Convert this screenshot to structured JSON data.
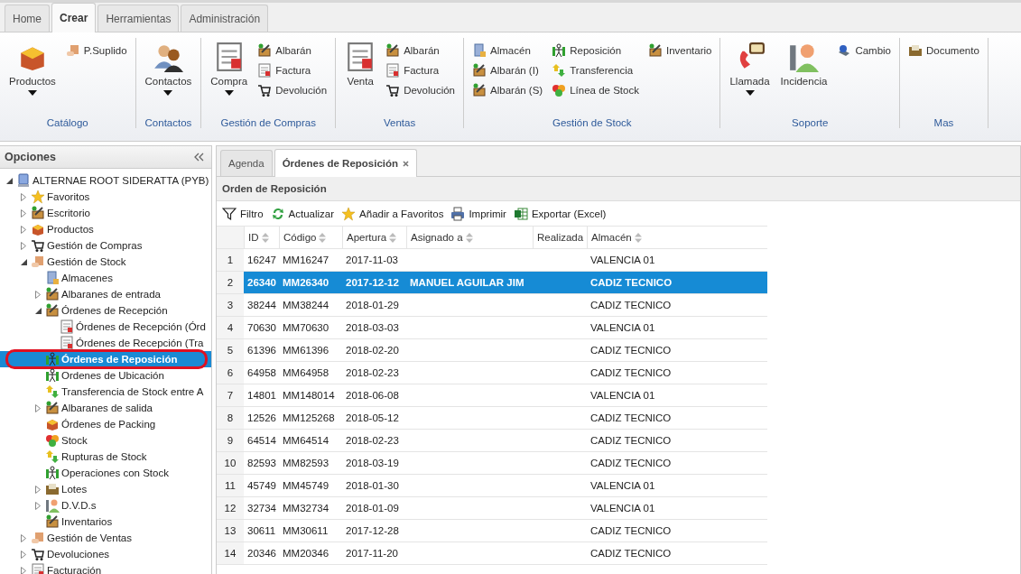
{
  "ribbon_tabs": [
    {
      "label": "Home",
      "selected": false
    },
    {
      "label": "Crear",
      "selected": true
    },
    {
      "label": "Herramientas",
      "selected": false
    },
    {
      "label": "Administración",
      "selected": false
    }
  ],
  "ribbon_groups": [
    {
      "label": "Catálogo",
      "large": [
        {
          "label": "Productos",
          "dropdown": true
        }
      ],
      "small": [
        "P.Suplido"
      ]
    },
    {
      "label": "Contactos",
      "large": [
        {
          "label": "Contactos",
          "dropdown": true
        }
      ]
    },
    {
      "label": "Gestión de Compras",
      "large": [
        {
          "label": "Compra",
          "dropdown": true
        }
      ],
      "small": [
        "Albarán",
        "Factura",
        "Devolución"
      ]
    },
    {
      "label": "Ventas",
      "large": [
        {
          "label": "Venta",
          "dropdown": false
        }
      ],
      "small": [
        "Albarán",
        "Factura",
        "Devolución"
      ]
    },
    {
      "label": "Gestión de Stock",
      "small": [
        "Almacén",
        "Albarán (I)",
        "Albarán (S)",
        "Reposición",
        "Transferencia",
        "Línea de Stock",
        "Inventario"
      ]
    },
    {
      "label": "Soporte",
      "large": [
        {
          "label": "Llamada",
          "dropdown": true
        },
        {
          "label": "Incidencia",
          "dropdown": false
        }
      ],
      "small": [
        "Cambio"
      ]
    },
    {
      "label": "Mas",
      "small": [
        "Documento"
      ]
    }
  ],
  "sidebar": {
    "title": "Opciones",
    "tree": [
      {
        "label": "ALTERNAE ROOT SIDERATTA (PYB)",
        "expanded": true,
        "selected": false,
        "children": [
          {
            "label": "Favoritos",
            "expanded": false,
            "selected": false
          },
          {
            "label": "Escritorio",
            "expanded": false,
            "selected": false
          },
          {
            "label": "Productos",
            "expanded": false,
            "selected": false
          },
          {
            "label": "Gestión de Compras",
            "expanded": false,
            "selected": false
          },
          {
            "label": "Gestión de Stock",
            "expanded": true,
            "selected": false,
            "children": [
              {
                "label": "Almacenes",
                "selected": false
              },
              {
                "label": "Albaranes de entrada",
                "expanded": false,
                "selected": false
              },
              {
                "label": "Órdenes de Recepción",
                "expanded": true,
                "selected": false,
                "children": [
                  {
                    "label": "Órdenes de Recepción (Órd",
                    "selected": false
                  },
                  {
                    "label": "Órdenes de Recepción (Tra",
                    "selected": false
                  }
                ]
              },
              {
                "label": "Órdenes de Reposición",
                "selected": true
              },
              {
                "label": "Ordenes de Ubicación",
                "selected": false
              },
              {
                "label": "Transferencia de Stock entre A",
                "selected": false
              },
              {
                "label": "Albaranes de salida",
                "expanded": false,
                "selected": false
              },
              {
                "label": "Órdenes de Packing",
                "selected": false
              },
              {
                "label": "Stock",
                "selected": false
              },
              {
                "label": "Rupturas de Stock",
                "selected": false
              },
              {
                "label": "Operaciones con Stock",
                "selected": false
              },
              {
                "label": "Lotes",
                "expanded": false,
                "selected": false
              },
              {
                "label": "D.V.D.s",
                "expanded": false,
                "selected": false
              },
              {
                "label": "Inventarios",
                "selected": false
              }
            ]
          },
          {
            "label": "Gestión de Ventas",
            "expanded": false,
            "selected": false
          },
          {
            "label": "Devoluciones",
            "expanded": false,
            "selected": false
          },
          {
            "label": "Facturación",
            "expanded": false,
            "selected": false
          }
        ]
      }
    ]
  },
  "content_tabs": [
    {
      "label": "Agenda",
      "selected": false,
      "closable": false
    },
    {
      "label": "Órdenes de Reposición",
      "selected": true,
      "closable": true
    }
  ],
  "panel": {
    "title": "Orden de Reposición",
    "toolbar": [
      "Filtro",
      "Actualizar",
      "Añadir a Favoritos",
      "Imprimir",
      "Exportar (Excel)"
    ],
    "table": {
      "columns": [
        {
          "label": "ID",
          "sortable": true
        },
        {
          "label": "Código",
          "sortable": true
        },
        {
          "label": "Apertura",
          "sortable": true
        },
        {
          "label": "Asignado a",
          "sortable": true
        },
        {
          "label": "Realizada",
          "sortable": false
        },
        {
          "label": "Almacén",
          "sortable": true
        }
      ],
      "rows": [
        {
          "num": "1",
          "cells": [
            "16247",
            "MM16247",
            "2017-11-03",
            "",
            "",
            "VALENCIA 01"
          ],
          "selected": false
        },
        {
          "num": "2",
          "cells": [
            "26340",
            "MM26340",
            "2017-12-12",
            "MANUEL AGUILAR JIM",
            "",
            "CADIZ TECNICO"
          ],
          "selected": true
        },
        {
          "num": "3",
          "cells": [
            "38244",
            "MM38244",
            "2018-01-29",
            "",
            "",
            "CADIZ TECNICO"
          ],
          "selected": false
        },
        {
          "num": "4",
          "cells": [
            "70630",
            "MM70630",
            "2018-03-03",
            "",
            "",
            "VALENCIA 01"
          ],
          "selected": false
        },
        {
          "num": "5",
          "cells": [
            "61396",
            "MM61396",
            "2018-02-20",
            "",
            "",
            "CADIZ TECNICO"
          ],
          "selected": false
        },
        {
          "num": "6",
          "cells": [
            "64958",
            "MM64958",
            "2018-02-23",
            "",
            "",
            "CADIZ TECNICO"
          ],
          "selected": false
        },
        {
          "num": "7",
          "cells": [
            "14801",
            "MM148014",
            "2018-06-08",
            "",
            "",
            "VALENCIA 01"
          ],
          "selected": false
        },
        {
          "num": "8",
          "cells": [
            "12526",
            "MM125268",
            "2018-05-12",
            "",
            "",
            "CADIZ TECNICO"
          ],
          "selected": false
        },
        {
          "num": "9",
          "cells": [
            "64514",
            "MM64514",
            "2018-02-23",
            "",
            "",
            "CADIZ TECNICO"
          ],
          "selected": false
        },
        {
          "num": "10",
          "cells": [
            "82593",
            "MM82593",
            "2018-03-19",
            "",
            "",
            "CADIZ TECNICO"
          ],
          "selected": false
        },
        {
          "num": "11",
          "cells": [
            "45749",
            "MM45749",
            "2018-01-30",
            "",
            "",
            "VALENCIA 01"
          ],
          "selected": false
        },
        {
          "num": "12",
          "cells": [
            "32734",
            "MM32734",
            "2018-01-09",
            "",
            "",
            "VALENCIA 01"
          ],
          "selected": false
        },
        {
          "num": "13",
          "cells": [
            "30611",
            "MM30611",
            "2017-12-28",
            "",
            "",
            "CADIZ TECNICO"
          ],
          "selected": false
        },
        {
          "num": "14",
          "cells": [
            "20346",
            "MM20346",
            "2017-11-20",
            "",
            "",
            "CADIZ TECNICO"
          ],
          "selected": false
        }
      ]
    }
  }
}
